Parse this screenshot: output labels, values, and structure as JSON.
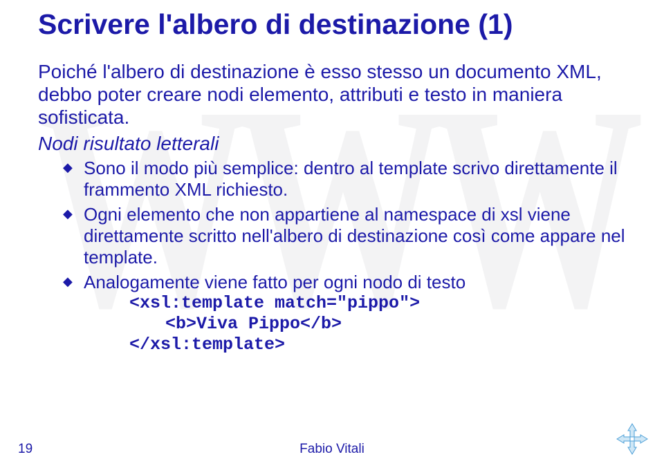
{
  "watermark": "WWW",
  "title": "Scrivere l'albero di destinazione (1)",
  "intro": "Poiché l'albero di destinazione è esso stesso un documento XML, debbo poter creare nodi elemento, attributi e testo in maniera sofisticata.",
  "subhead": "Nodi risultato letterali",
  "bullets": [
    "Sono il modo più semplice: dentro al template scrivo direttamente il frammento XML richiesto.",
    "Ogni elemento che non appartiene al namespace di xsl viene direttamente scritto nell'albero di destinazione così come appare nel template.",
    "Analogamente viene fatto per ogni nodo di testo"
  ],
  "code": {
    "line1": "<xsl:template match=\"pippo\">",
    "line2": "<b>Viva Pippo</b>",
    "line3": "</xsl:template>"
  },
  "footer": {
    "page": "19",
    "author": "Fabio Vitali"
  }
}
